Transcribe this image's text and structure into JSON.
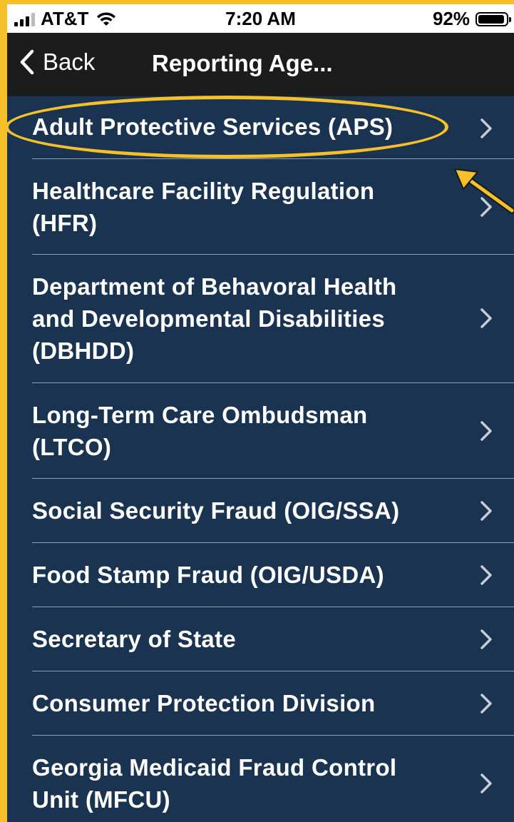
{
  "status_bar": {
    "carrier": "AT&T",
    "time": "7:20 AM",
    "battery": "92%"
  },
  "nav": {
    "back_label": "Back",
    "title": "Reporting Age..."
  },
  "agencies": [
    {
      "line1": "Adult Protective Services (APS)"
    },
    {
      "line1": "Healthcare Facility Regulation",
      "line2": "(HFR)"
    },
    {
      "line1": "Department of Behavoral Health",
      "line2": "and Developmental Disabilities",
      "line3": "(DBHDD)"
    },
    {
      "line1": "Long-Term Care Ombudsman",
      "line2": "(LTCO)"
    },
    {
      "line1": "Social Security Fraud (OIG/SSA)"
    },
    {
      "line1": "Food Stamp Fraud (OIG/USDA)"
    },
    {
      "line1": "Secretary of State"
    },
    {
      "line1": "Consumer Protection Division"
    },
    {
      "line1": "Georgia Medicaid Fraud Control",
      "line2": "Unit (MFCU)"
    }
  ],
  "colors": {
    "list_background": "#193351",
    "nav_background": "#1c1c1d",
    "annotation_highlight": "#f5c02a"
  }
}
